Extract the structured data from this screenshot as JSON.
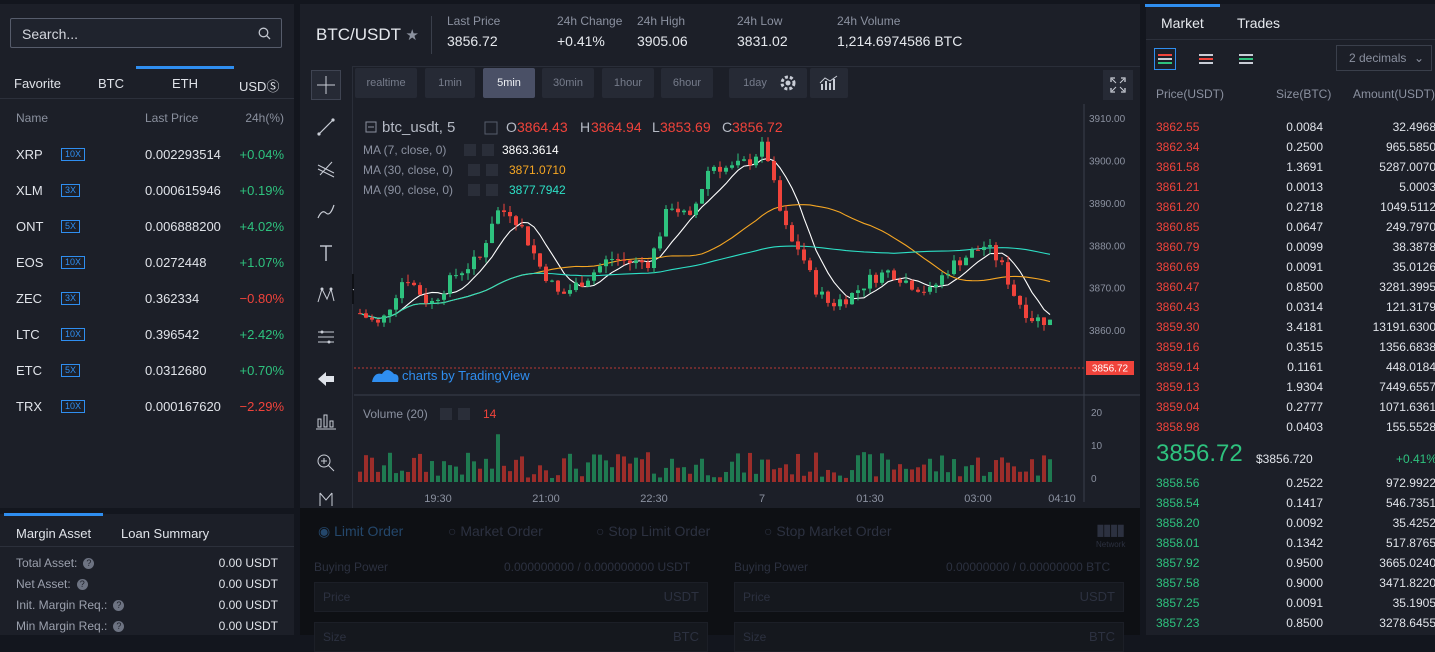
{
  "search": {
    "placeholder": "Search..."
  },
  "market_tabs": [
    "Favorite",
    "BTC",
    "ETH",
    "USDⓈ"
  ],
  "market_cols": [
    "Name",
    "Last Price",
    "24h(%)"
  ],
  "markets": [
    {
      "sym": "XRP",
      "lev": "10X",
      "price": "0.002293514",
      "chg": "+0.04%",
      "dir": "up"
    },
    {
      "sym": "XLM",
      "lev": "3X",
      "price": "0.000615946",
      "chg": "+0.19%",
      "dir": "up"
    },
    {
      "sym": "ONT",
      "lev": "5X",
      "price": "0.006888200",
      "chg": "+4.02%",
      "dir": "up"
    },
    {
      "sym": "EOS",
      "lev": "10X",
      "price": "0.0272448",
      "chg": "+1.07%",
      "dir": "up"
    },
    {
      "sym": "ZEC",
      "lev": "3X",
      "price": "0.362334",
      "chg": "−0.80%",
      "dir": "dn"
    },
    {
      "sym": "LTC",
      "lev": "10X",
      "price": "0.396542",
      "chg": "+2.42%",
      "dir": "up"
    },
    {
      "sym": "ETC",
      "lev": "5X",
      "price": "0.0312680",
      "chg": "+0.70%",
      "dir": "up"
    },
    {
      "sym": "TRX",
      "lev": "10X",
      "price": "0.000167620",
      "chg": "−2.29%",
      "dir": "dn"
    }
  ],
  "bottom_tabs": [
    "Margin Asset",
    "Loan Summary"
  ],
  "margin": [
    {
      "label": "Total Asset:",
      "value": "0.00 USDT"
    },
    {
      "label": "Net Asset:",
      "value": "0.00 USDT"
    },
    {
      "label": "Init. Margin Req.:",
      "value": "0.00 USDT"
    },
    {
      "label": "Min Margin Req.:",
      "value": "0.00 USDT"
    }
  ],
  "header": {
    "pair": "BTC/USDT",
    "stats": [
      {
        "label": "Last Price",
        "value": "3856.72",
        "dir": ""
      },
      {
        "label": "24h Change",
        "value": "+0.41%",
        "dir": "up"
      },
      {
        "label": "24h High",
        "value": "3905.06",
        "dir": ""
      },
      {
        "label": "24h Low",
        "value": "3831.02",
        "dir": ""
      },
      {
        "label": "24h Volume",
        "value": "1,214.6974586 BTC",
        "dir": ""
      }
    ]
  },
  "intervals": [
    "realtime",
    "1min",
    "5min",
    "30min",
    "1hour",
    "6hour",
    "1day"
  ],
  "active_interval": "5min",
  "chart_data": {
    "type": "candlestick",
    "symbol": "btc_usdt, 5",
    "ohlc_labels": {
      "O": "3864.43",
      "H": "3864.94",
      "L": "3853.69",
      "C": "3856.72"
    },
    "indicators": [
      {
        "label": "MA (7, close, 0)",
        "value": "3863.3614",
        "color": "#ffffff"
      },
      {
        "label": "MA (30, close, 0)",
        "value": "3871.0710",
        "color": "#f5a623"
      },
      {
        "label": "MA (90, close, 0)",
        "value": "3877.7942",
        "color": "#2de0c6"
      }
    ],
    "y_ticks": [
      "3910.00",
      "3900.00",
      "3890.00",
      "3880.00",
      "3870.00",
      "3860.00"
    ],
    "ylim": [
      3852,
      3911
    ],
    "last_price_tag": "3856.72",
    "x_ticks": [
      "19:30",
      "21:00",
      "22:30",
      "7",
      "01:30",
      "03:00",
      "04:10"
    ],
    "volume_label": "Volume (20)",
    "volume_value": "14",
    "volume_ticks": [
      "20",
      "10",
      "0"
    ],
    "watermark": "charts by TradingView",
    "up_color": "#2ec27e",
    "down_color": "#f0433b"
  },
  "order_form": {
    "types": [
      "Limit Order",
      "Market Order",
      "Stop Limit Order",
      "Stop Market Order"
    ],
    "network": "Network",
    "buy_power_label": "Buying Power",
    "buy_power": "0.000000000 / 0.000000000 USDT",
    "sell_power": "0.00000000 / 0.00000000 BTC",
    "price_label": "Price",
    "buy_unit": "USDT",
    "sell_unit": "USDT",
    "size_label": "Size",
    "size_unit": "BTC"
  },
  "right": {
    "tabs": [
      "Market",
      "Trades"
    ],
    "decimals": "2 decimals",
    "cols": [
      "Price(USDT)",
      "Size(BTC)",
      "Amount(USDT)"
    ],
    "asks": [
      {
        "p": "3862.55",
        "s": "0.0084",
        "a": "32.4968"
      },
      {
        "p": "3862.34",
        "s": "0.2500",
        "a": "965.5850"
      },
      {
        "p": "3861.58",
        "s": "1.3691",
        "a": "5287.0070"
      },
      {
        "p": "3861.21",
        "s": "0.0013",
        "a": "5.0003"
      },
      {
        "p": "3861.20",
        "s": "0.2718",
        "a": "1049.5112"
      },
      {
        "p": "3860.85",
        "s": "0.0647",
        "a": "249.7970"
      },
      {
        "p": "3860.79",
        "s": "0.0099",
        "a": "38.3878"
      },
      {
        "p": "3860.69",
        "s": "0.0091",
        "a": "35.0126"
      },
      {
        "p": "3860.47",
        "s": "0.8500",
        "a": "3281.3995"
      },
      {
        "p": "3860.43",
        "s": "0.0314",
        "a": "121.3179"
      },
      {
        "p": "3859.30",
        "s": "3.4181",
        "a": "13191.6300"
      },
      {
        "p": "3859.16",
        "s": "0.3515",
        "a": "1356.6838"
      },
      {
        "p": "3859.14",
        "s": "0.1161",
        "a": "448.0184"
      },
      {
        "p": "3859.13",
        "s": "1.9304",
        "a": "7449.6557"
      },
      {
        "p": "3859.04",
        "s": "0.2777",
        "a": "1071.6361"
      },
      {
        "p": "3858.98",
        "s": "0.0403",
        "a": "155.5528"
      }
    ],
    "last_price": "3856.72",
    "last_usd": "$3856.720",
    "last_change": "+0.41%",
    "bids": [
      {
        "p": "3858.56",
        "s": "0.2522",
        "a": "972.9922"
      },
      {
        "p": "3858.54",
        "s": "0.1417",
        "a": "546.7351"
      },
      {
        "p": "3858.20",
        "s": "0.0092",
        "a": "35.4252"
      },
      {
        "p": "3858.01",
        "s": "0.1342",
        "a": "517.8765"
      },
      {
        "p": "3857.92",
        "s": "0.9500",
        "a": "3665.0240"
      },
      {
        "p": "3857.58",
        "s": "0.9000",
        "a": "3471.8220"
      },
      {
        "p": "3857.25",
        "s": "0.0091",
        "a": "35.1905"
      },
      {
        "p": "3857.23",
        "s": "0.8500",
        "a": "3278.6455"
      }
    ]
  }
}
